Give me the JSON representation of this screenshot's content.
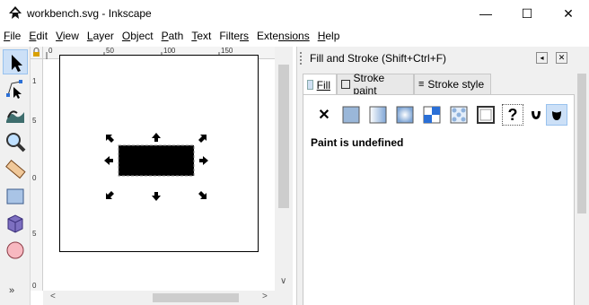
{
  "window": {
    "title": "workbench.svg - Inkscape",
    "controls": {
      "minimize": "—",
      "maximize": "☐",
      "close": "✕"
    }
  },
  "menu": [
    {
      "first": "F",
      "rest": "ile"
    },
    {
      "first": "E",
      "rest": "dit"
    },
    {
      "first": "V",
      "rest": "iew"
    },
    {
      "first": "L",
      "rest": "ayer"
    },
    {
      "first": "O",
      "rest": "bject"
    },
    {
      "first": "P",
      "rest": "ath"
    },
    {
      "first": "T",
      "rest": "ext"
    },
    {
      "first": "Filte",
      "rest": "rs",
      "ul_second": true
    },
    {
      "first": "Exte",
      "rest": "nsions",
      "ul_second": true
    },
    {
      "first": "H",
      "rest": "elp"
    }
  ],
  "toolbox": {
    "tools": [
      "selector-tool",
      "node-tool",
      "tweak-tool",
      "zoom-tool",
      "measure-tool",
      "rectangle-tool",
      "3d-box-tool",
      "ellipse-tool"
    ],
    "active_tool": "selector-tool",
    "more": "»"
  },
  "rulers": {
    "horizontal": [
      "0",
      "50",
      "100",
      "150"
    ],
    "vertical": [
      "1",
      "5",
      "0",
      "5",
      "0"
    ]
  },
  "dock": {
    "title": "Fill and Stroke (Shift+Ctrl+F)",
    "tabs": [
      {
        "label": "Fill",
        "underline_first": true
      },
      {
        "label": "Stroke paint"
      },
      {
        "label": "Stroke style"
      }
    ],
    "active_tab": "Fill",
    "paint_types": [
      "no-paint",
      "flat-color",
      "linear-gradient",
      "radial-gradient",
      "mesh-gradient",
      "pattern",
      "swatch",
      "unset-paint",
      "nonzero-fill-rule",
      "evenodd-fill-rule"
    ],
    "message": "Paint is undefined"
  },
  "colors": {
    "accent": "#cce0f7",
    "selected_rect_fill": "#000000"
  }
}
